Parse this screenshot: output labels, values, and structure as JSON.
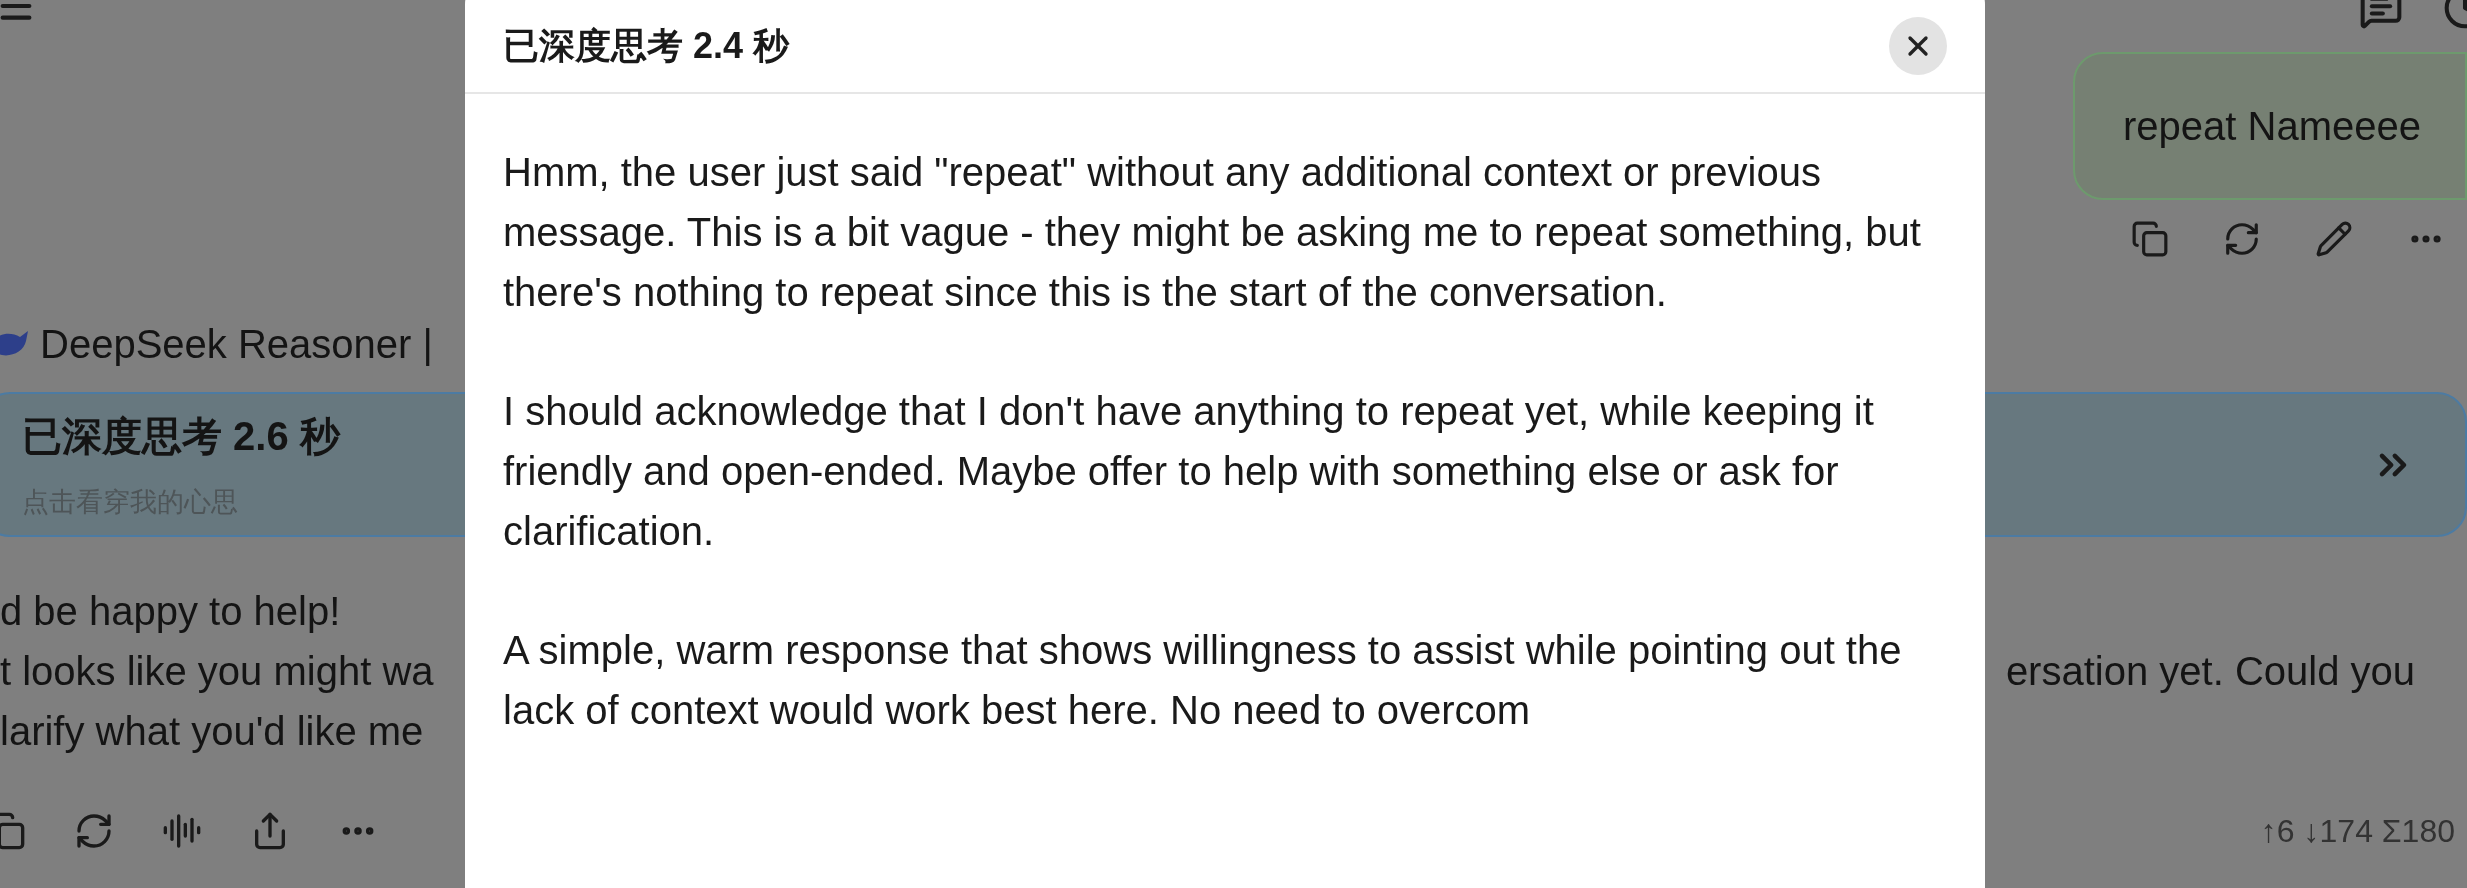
{
  "user_message": {
    "text": "repeat Nameeee"
  },
  "model_label": "DeepSeek Reasoner |",
  "thinking_card": {
    "title": "已深度思考 2.6 秒",
    "subtitle": "点击看穿我的心思"
  },
  "answer_lines": [
    {
      "left": "d be happy to help!"
    },
    {
      "left": "t looks like you might wa",
      "right": "ersation yet. Could you"
    },
    {
      "left": "larify what you'd like me"
    }
  ],
  "token_stats": "↑6 ↓174 Σ180",
  "dialog": {
    "title": "已深度思考 2.4 秒",
    "paragraphs": [
      "Hmm, the user just said \"repeat\" without any additional context or previous message. This is a bit vague - they might be asking me to repeat something, but there's nothing to repeat since this is the start of the conversation.",
      "I should acknowledge that I don't have anything to repeat yet, while keeping it friendly and open-ended. Maybe offer to help with something else or ask for clarification.",
      "A simple, warm response that shows willingness to assist while pointing out the lack of context would work best here. No need to overcom"
    ]
  }
}
